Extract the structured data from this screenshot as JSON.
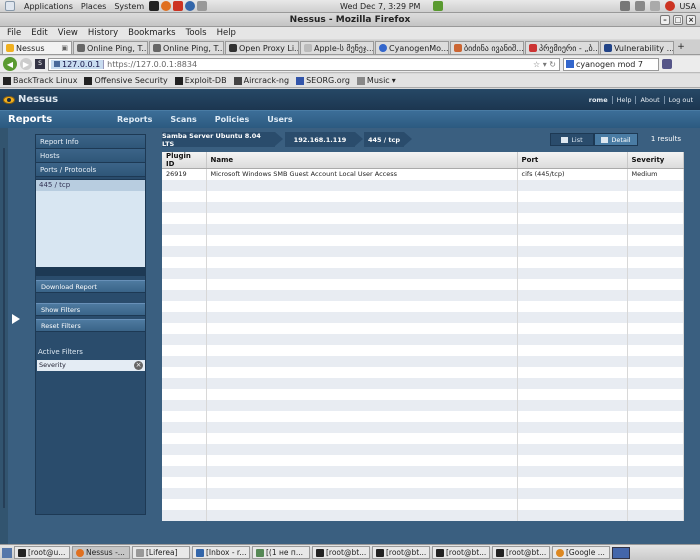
{
  "gnome_panel": {
    "menus": [
      "Applications",
      "Places",
      "System"
    ],
    "clock": "Wed Dec  7,  3:29 PM",
    "locale": "USA"
  },
  "window": {
    "title": "Nessus - Mozilla Firefox"
  },
  "menubar": [
    "File",
    "Edit",
    "View",
    "History",
    "Bookmarks",
    "Tools",
    "Help"
  ],
  "tabs": [
    {
      "label": "Nessus",
      "icon_color": "#f0b020",
      "active": true
    },
    {
      "label": "Online Ping, T...",
      "icon_color": "#666666",
      "active": false
    },
    {
      "label": "Online Ping, T...",
      "icon_color": "#666666",
      "active": false
    },
    {
      "label": "Open Proxy Li...",
      "icon_color": "#333333",
      "active": false
    },
    {
      "label": "Apple-ს მენეჯ...",
      "icon_color": "#bbbbbb",
      "active": false
    },
    {
      "label": "CyanogenMo...",
      "icon_color": "#3366cc",
      "active": false
    },
    {
      "label": "ბიძინა ივანიშ...",
      "icon_color": "#cc6633",
      "active": false
    },
    {
      "label": "პრემიერი - „ბ...",
      "icon_color": "#cc3333",
      "active": false
    },
    {
      "label": "Vulnerability ...",
      "icon_color": "#224488",
      "active": false
    }
  ],
  "navbar": {
    "url_identity": "127.0.0.1",
    "url": "https://127.0.0.1:8834",
    "search_value": "cyanogen mod 7"
  },
  "bookmarks": [
    {
      "label": "BackTrack Linux",
      "icon_color": "#222222"
    },
    {
      "label": "Offensive Security",
      "icon_color": "#222222"
    },
    {
      "label": "Exploit-DB",
      "icon_color": "#222222"
    },
    {
      "label": "Aircrack-ng",
      "icon_color": "#444444"
    },
    {
      "label": "SEORG.org",
      "icon_color": "#3355aa"
    },
    {
      "label": "Music",
      "icon_color": "#888888"
    }
  ],
  "nessus": {
    "logo": "Nessus",
    "header_links": [
      "rome",
      "Help",
      "About",
      "Log out"
    ],
    "section_title": "Reports",
    "nav_tabs": [
      "Reports",
      "Scans",
      "Policies",
      "Users"
    ],
    "sidebar": {
      "items": [
        "Report Info",
        "Hosts",
        "Ports / Protocols"
      ],
      "ports": [
        "445 / tcp"
      ],
      "download_button": "Download Report",
      "show_filters_button": "Show Filters",
      "reset_filters_button": "Reset Filters",
      "active_filters_label": "Active Filters",
      "filters": [
        "Severity"
      ]
    },
    "breadcrumb": [
      "Samba Server Ubuntu 8.04 LTS",
      "192.168.1.119",
      "445 / tcp"
    ],
    "view_toggle": {
      "list": "List",
      "detail": "Detail"
    },
    "result_count": "1   results",
    "table": {
      "columns": [
        "Plugin ID",
        "Name",
        "Port",
        "Severity"
      ],
      "rows": [
        {
          "plugin_id": "26919",
          "name": "Microsoft Windows SMB Guest Account Local User Access",
          "port": "cifs (445/tcp)",
          "severity": "Medium"
        }
      ]
    }
  },
  "taskbar": [
    {
      "label": "[root@u...",
      "active": false
    },
    {
      "label": "Nessus -...",
      "active": true
    },
    {
      "label": "[Liferea]",
      "active": false
    },
    {
      "label": "[Inbox - r...",
      "active": false
    },
    {
      "label": "[(1 не п...",
      "active": false
    },
    {
      "label": "[root@bt...",
      "active": false
    },
    {
      "label": "[root@bt...",
      "active": false
    },
    {
      "label": "[root@bt...",
      "active": false
    },
    {
      "label": "[root@bt...",
      "active": false
    },
    {
      "label": "[Google ...",
      "active": false
    }
  ]
}
